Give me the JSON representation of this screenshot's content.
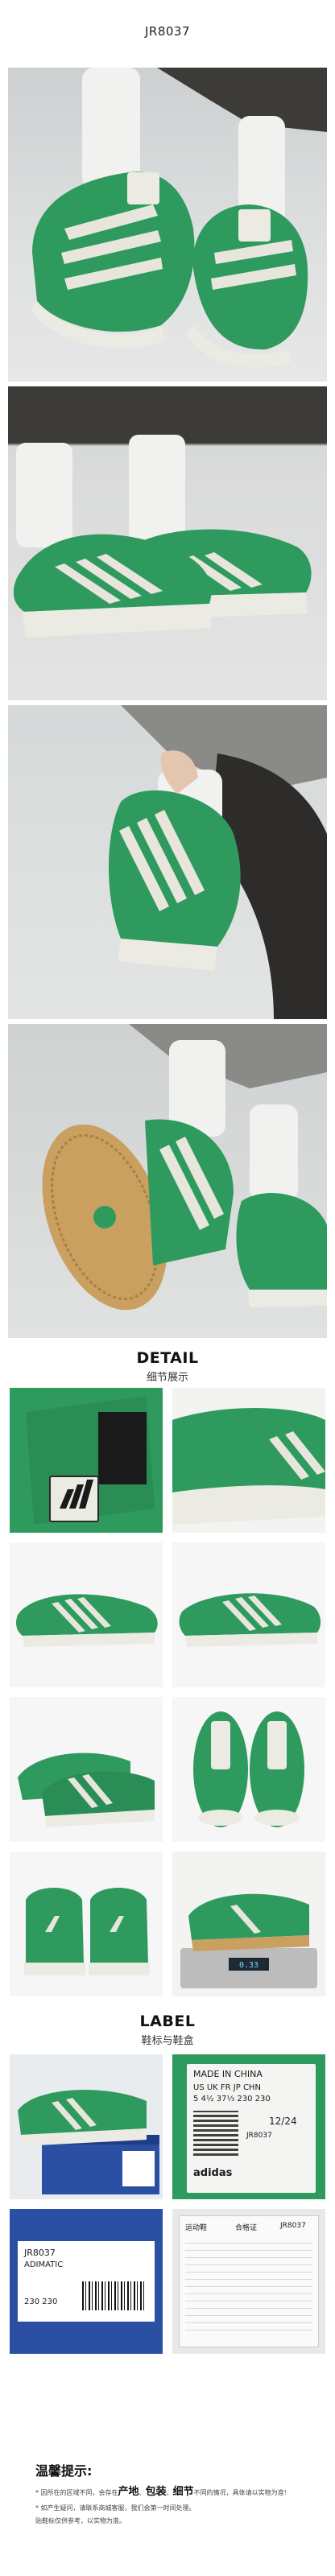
{
  "product_code": "JR8037",
  "detail_section": {
    "title": "DETAIL",
    "subtitle": "细节展示"
  },
  "label_section": {
    "title": "LABEL",
    "subtitle": "鞋标与鞋盒"
  },
  "tag_label": {
    "made_in": "MADE IN CHINA",
    "size_regions": "US UK FR JP CHN",
    "size_values": "5  4½ 37⅓ 230 230",
    "date": "12/24",
    "article": "JR8037",
    "brand": "adidas"
  },
  "box_label": {
    "code": "JR8037",
    "name": "ADIMATIC",
    "sizes": "230  230"
  },
  "receipt": {
    "title": "合格证",
    "code": "JR8037",
    "brand_line": "运动鞋"
  },
  "scale_reading": "0.33",
  "tips": {
    "title": "温馨提示:",
    "line1_prefix": "* 因所在的区域不同，会存在",
    "keywords": [
      "产地",
      "包装",
      "细节"
    ],
    "line1_suffix": "不同的情况，具体请以实物为准!",
    "line2": "* 如产生疑问，请联系商城客服，我们会第一时间处理。",
    "line3": "贴鞋标仅供参考，以实物为准。"
  },
  "colors": {
    "shoe_green": "#2f9a5e",
    "shoe_green_dark": "#237a4a",
    "stripe_white": "#e8e6dc",
    "sole_white": "#ecebe3",
    "gum": "#c9a060",
    "sock": "#f3f3f1",
    "pants": "#3c3b37"
  }
}
